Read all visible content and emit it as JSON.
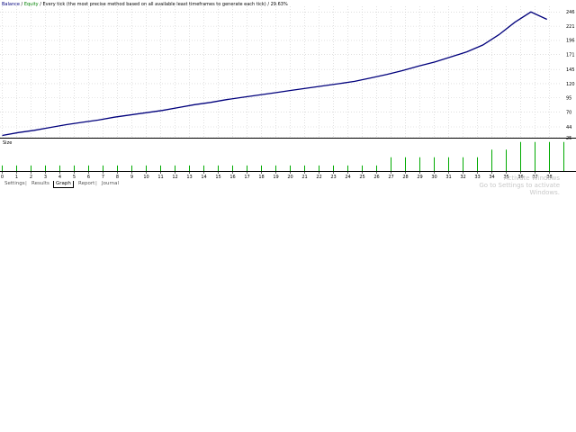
{
  "legend": {
    "balance": "Balance",
    "equity": "Equity",
    "sep1": " / ",
    "model_text": " / Every tick (the most precise method based on all available least timeframes to generate each tick)",
    "quality_text": " / 29.63%"
  },
  "volume_panel_label": "Size",
  "tabs": [
    {
      "label": "Settings",
      "active": false
    },
    {
      "label": "Results",
      "active": false
    },
    {
      "label": "Graph",
      "active": true
    },
    {
      "label": "Report",
      "active": false
    },
    {
      "label": "Journal",
      "active": false
    }
  ],
  "watermark": {
    "line1": "Activate Windows",
    "line2": "Go to Settings to activate Windows."
  },
  "colors": {
    "balance": "#00007c",
    "equity": "#008000",
    "volume": "#00aa00",
    "grid": "#cccccc",
    "axis": "#000000"
  },
  "chart_data": {
    "type": "line",
    "x_labels": [
      "0",
      "1",
      "2",
      "3",
      "4",
      "5",
      "6",
      "7",
      "8",
      "9",
      "10",
      "11",
      "12",
      "13",
      "14",
      "15",
      "16",
      "17",
      "18",
      "19",
      "20",
      "21",
      "22",
      "23",
      "24",
      "25",
      "26",
      "27",
      "28",
      "29",
      "30",
      "31",
      "32",
      "33",
      "34",
      "35",
      "36",
      "37",
      "38"
    ],
    "y_ticks": [
      "25",
      "44",
      "70",
      "95",
      "120",
      "145",
      "171",
      "196",
      "221",
      "246"
    ],
    "ylim": [
      25,
      256
    ],
    "series": [
      {
        "name": "Balance",
        "values": [
          29,
          34,
          38,
          43,
          48,
          52,
          56,
          61,
          65,
          69,
          73,
          78,
          83,
          87,
          92,
          96,
          100,
          104,
          108,
          112,
          116,
          120,
          124,
          130,
          136,
          143,
          151,
          158,
          167,
          176,
          188,
          206,
          228,
          246,
          233
        ]
      }
    ],
    "series_x": [
      0,
      1,
      2,
      3,
      4,
      5,
      6,
      7,
      8,
      9,
      10,
      11,
      12,
      13,
      14,
      15,
      16,
      17,
      18,
      19,
      20,
      21,
      22,
      23,
      24,
      25,
      26,
      27,
      28,
      29,
      30,
      31,
      32,
      33,
      34,
      35,
      36,
      37,
      38
    ],
    "volume": {
      "name": "Size",
      "values": [
        0.18,
        0.18,
        0.18,
        0.18,
        0.18,
        0.18,
        0.18,
        0.18,
        0.18,
        0.18,
        0.18,
        0.18,
        0.18,
        0.18,
        0.18,
        0.18,
        0.18,
        0.18,
        0.18,
        0.18,
        0.18,
        0.18,
        0.18,
        0.18,
        0.18,
        0.18,
        0.18,
        0.45,
        0.45,
        0.45,
        0.45,
        0.45,
        0.45,
        0.45,
        0.7,
        0.7,
        0.95,
        0.95,
        0.95,
        0.95
      ]
    }
  }
}
